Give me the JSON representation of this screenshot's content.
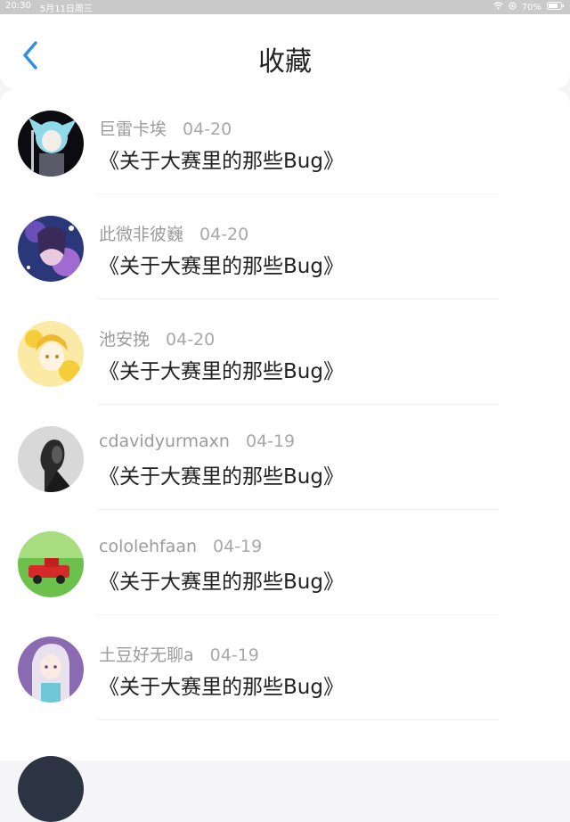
{
  "status_bar": {
    "time": "20:30",
    "date": "5月11日周三",
    "battery": "70%"
  },
  "nav": {
    "title": "收藏"
  },
  "favorites": [
    {
      "author": "巨雷卡埃",
      "date": "04-20",
      "title": "《关于大赛里的那些Bug》"
    },
    {
      "author": "此微非彼巍",
      "date": "04-20",
      "title": "《关于大赛里的那些Bug》"
    },
    {
      "author": "池安挽",
      "date": "04-20",
      "title": "《关于大赛里的那些Bug》"
    },
    {
      "author": "cdavidyurmaxn",
      "date": "04-19",
      "title": "《关于大赛里的那些Bug》"
    },
    {
      "author": "cololehfaan",
      "date": "04-19",
      "title": "《关于大赛里的那些Bug》"
    },
    {
      "author": "土豆好无聊a",
      "date": "04-19",
      "title": "《关于大赛里的那些Bug》"
    }
  ],
  "colors": {
    "accent": "#2f8de4",
    "background": "#f5f5f7",
    "meta_text": "#9b9b9b",
    "title_text": "#222222"
  },
  "icons": {
    "back": "chevron-left-icon",
    "wifi": "wifi-icon",
    "battery": "battery-icon"
  }
}
